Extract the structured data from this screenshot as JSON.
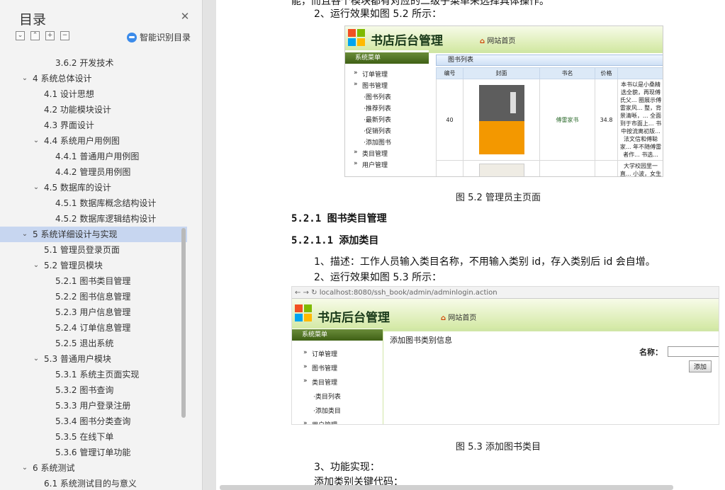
{
  "sidebar": {
    "title": "目录",
    "close_icon": "close-icon",
    "tools": [
      "collapse-all-icon",
      "expand-up-icon",
      "plus-icon",
      "minus-icon"
    ],
    "smart_label": "智能识别目录",
    "items": [
      {
        "text": "3.6.2 开发技术",
        "level": 3,
        "chev": ""
      },
      {
        "text": "4  系统总体设计",
        "level": 1,
        "chev": "v"
      },
      {
        "text": "4.1 设计思想",
        "level": 2,
        "chev": ""
      },
      {
        "text": "4.2 功能模块设计",
        "level": 2,
        "chev": ""
      },
      {
        "text": "4.3 界面设计",
        "level": 2,
        "chev": ""
      },
      {
        "text": "4.4 系统用户用例图",
        "level": 2,
        "chev": "v"
      },
      {
        "text": "4.4.1 普通用户用例图",
        "level": 3,
        "chev": ""
      },
      {
        "text": "4.4.2 管理员用例图",
        "level": 3,
        "chev": ""
      },
      {
        "text": "4.5  数据库的设计",
        "level": 2,
        "chev": "v"
      },
      {
        "text": "4.5.1 数据库概念结构设计",
        "level": 3,
        "chev": ""
      },
      {
        "text": "4.5.2  数据库逻辑结构设计",
        "level": 3,
        "chev": ""
      },
      {
        "text": "5  系统详细设计与实现",
        "level": 1,
        "chev": "v",
        "active": true
      },
      {
        "text": "5.1 管理员登录页面",
        "level": 2,
        "chev": ""
      },
      {
        "text": "5.2 管理员模块",
        "level": 2,
        "chev": "v"
      },
      {
        "text": "5.2.1 图书类目管理",
        "level": 3,
        "chev": ""
      },
      {
        "text": "5.2.2 图书信息管理",
        "level": 3,
        "chev": ""
      },
      {
        "text": "5.2.3 用户信息管理",
        "level": 3,
        "chev": ""
      },
      {
        "text": "5.2.4 订单信息管理",
        "level": 3,
        "chev": ""
      },
      {
        "text": "5.2.5 退出系统",
        "level": 3,
        "chev": ""
      },
      {
        "text": "5.3 普通用户模块",
        "level": 2,
        "chev": "v"
      },
      {
        "text": "5.3.1 系统主页面实现",
        "level": 3,
        "chev": ""
      },
      {
        "text": "5.3.2 图书查询",
        "level": 3,
        "chev": ""
      },
      {
        "text": "5.3.3 用户登录注册",
        "level": 3,
        "chev": ""
      },
      {
        "text": "5.3.4 图书分类查询",
        "level": 3,
        "chev": ""
      },
      {
        "text": "5.3.5 在线下单",
        "level": 3,
        "chev": ""
      },
      {
        "text": "5.3.6 管理订单功能",
        "level": 3,
        "chev": ""
      },
      {
        "text": "6  系统测试",
        "level": 1,
        "chev": "v"
      },
      {
        "text": "6.1 系统测试目的与意义",
        "level": 2,
        "chev": ""
      }
    ]
  },
  "doc": {
    "line_top": "能，而且各个模块都有对应的二级子菜单来选择具体操作。",
    "p_run1": "2、运行效果如图 5.2 所示：",
    "caption1": "图 5.2  管理员主页面",
    "h_521": "5.2.1 图书类目管理",
    "h_5211": "5.2.1.1 添加类目",
    "p_desc": "1、描述：工作人员输入类目名称，不用输入类别 id，存入类别后 id 会自增。",
    "p_run2": "2、运行效果如图 5.3 所示：",
    "caption2": "图 5.3  添加图书类目",
    "p_func": "3、功能实现：",
    "p_code": "添加类别关键代码："
  },
  "shot1": {
    "brand": "书店后台管理",
    "home": "网站首页",
    "menu_head": "系统菜单",
    "menu": [
      "订单管理",
      "图书管理",
      "·图书列表",
      "·推荐列表",
      "·最新列表",
      "·促销列表",
      "·添加图书",
      "类目管理",
      "用户管理"
    ],
    "panel_title": "图书列表",
    "columns": [
      "编号",
      "封面",
      "书名",
      "价格"
    ],
    "row": {
      "id": "40",
      "name": "傅雷家书",
      "price": "34.8",
      "desc": "本书以是小桑精选全貌，再现傅氏父... 圈展示傅雷家风... 整，背景清晰，... 全面到于市面上... 书中按流离初版... 法文信和傅聪家... 年不随傅雷者作... 书选..."
    },
    "row2_desc": "大学校园里一直... 小波，女生不可... 说... "
  },
  "shot2": {
    "url": "localhost:8080/ssh_book/admin/adminlogin.action",
    "brand": "书店后台管理",
    "home": "网站首页",
    "menu_head": "系统菜单",
    "menu": [
      "订单管理",
      "图书管理",
      "类目管理",
      "·类目列表",
      "·添加类目",
      "用户管理"
    ],
    "panel_title": "添加图书类别信息",
    "name_label": "名称：",
    "add_button": "添加"
  }
}
